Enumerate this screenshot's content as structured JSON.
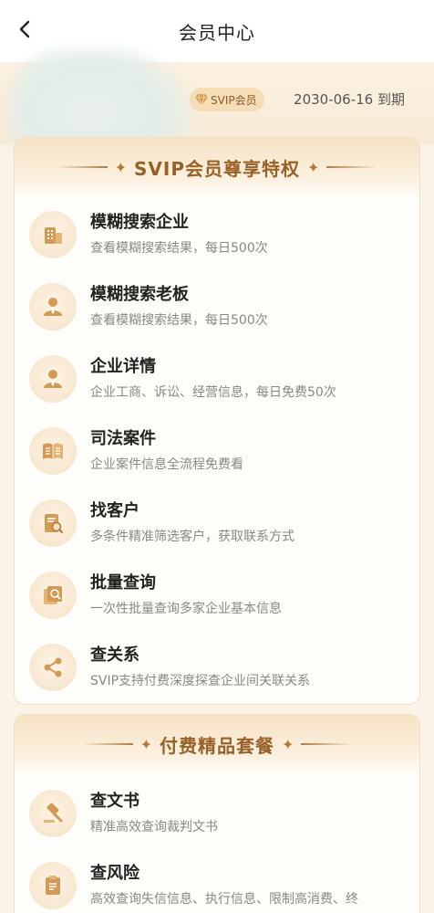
{
  "header": {
    "title": "会员中心",
    "back_icon": "chevron-left-icon"
  },
  "member": {
    "badge": "SVIP会员",
    "expire": "2030-06-16 到期"
  },
  "colors": {
    "accent": "#b27a3d",
    "head_text": "#9a6127",
    "card_bg": "#fffdf9"
  },
  "svip_card": {
    "title": "SVIP会员尊享特权",
    "items": [
      {
        "title": "模糊搜索企业",
        "desc": "查看模糊搜索结果，每日500次",
        "icon": "building-icon"
      },
      {
        "title": "模糊搜索老板",
        "desc": "查看模糊搜索结果，每日500次",
        "icon": "person-icon"
      },
      {
        "title": "企业详情",
        "desc": "企业工商、诉讼、经营信息，每日免费50次",
        "icon": "person-icon"
      },
      {
        "title": "司法案件",
        "desc": "企业案件信息全流程免费看",
        "icon": "book-icon"
      },
      {
        "title": "找客户",
        "desc": "多条件精准筛选客户，获取联系方式",
        "icon": "document-search-icon"
      },
      {
        "title": "批量查询",
        "desc": "一次性批量查询多家企业基本信息",
        "icon": "batch-search-icon"
      },
      {
        "title": "查关系",
        "desc": "SVIP支持付费深度探查企业间关联关系",
        "icon": "share-icon"
      }
    ]
  },
  "paid_card": {
    "title": "付费精品套餐",
    "items": [
      {
        "title": "查文书",
        "desc": "精准高效查询裁判文书",
        "icon": "gavel-icon"
      },
      {
        "title": "查风险",
        "desc": "高效查询失信信息、执行信息、限制高消费、终",
        "icon": "clipboard-icon"
      }
    ]
  }
}
